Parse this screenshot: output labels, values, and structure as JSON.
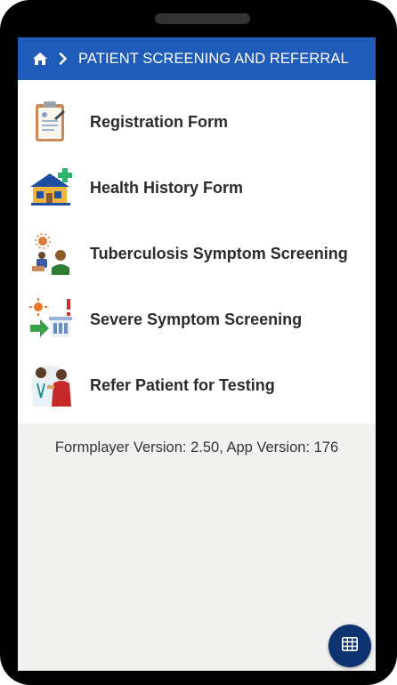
{
  "header": {
    "title": "PATIENT SCREENING AND REFERRAL",
    "home_icon": "home-icon",
    "separator_icon": "chevron-right-icon",
    "background": "#1f5bb8"
  },
  "menu": {
    "items": [
      {
        "label": "Registration Form",
        "icon": "clipboard-icon"
      },
      {
        "label": "Health History Form",
        "icon": "house-medical-icon"
      },
      {
        "label": "Tuberculosis Symptom Screening",
        "icon": "tb-screening-icon"
      },
      {
        "label": "Severe Symptom Screening",
        "icon": "severe-symptom-icon"
      },
      {
        "label": "Refer Patient for Testing",
        "icon": "referral-icon"
      }
    ]
  },
  "footer": {
    "version_text": "Formplayer Version: 2.50, App Version: 176"
  },
  "fab": {
    "icon": "grid-icon",
    "background": "#0d3370"
  }
}
